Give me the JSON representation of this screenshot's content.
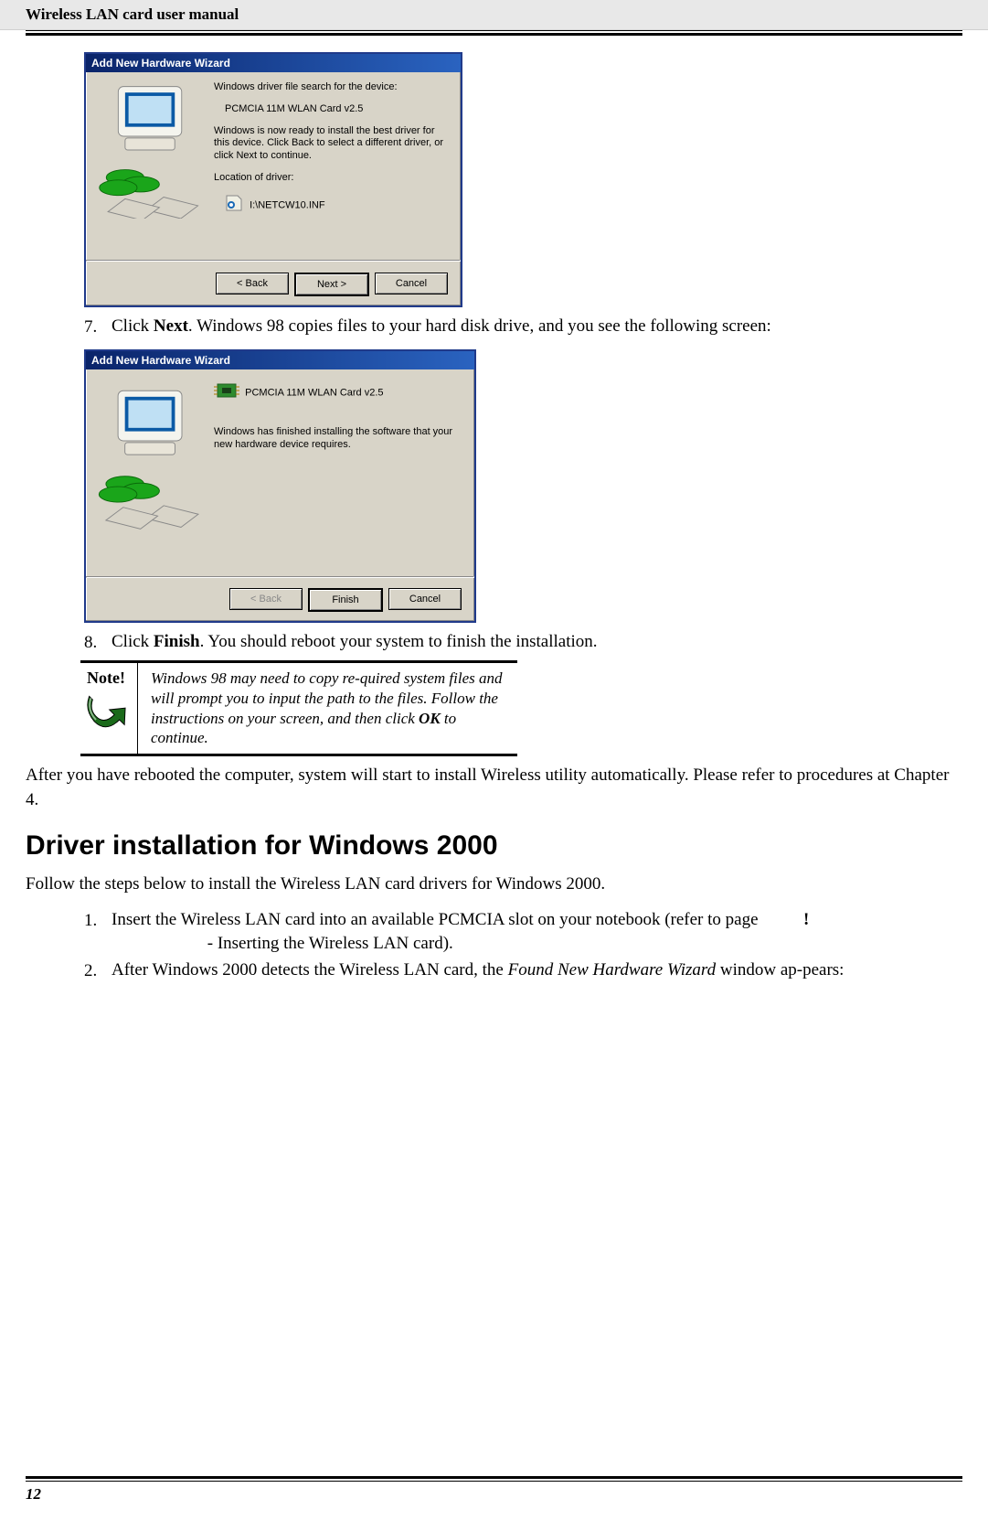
{
  "header": {
    "title": "Wireless LAN card user manual"
  },
  "screenshot1": {
    "titlebar": "Add New Hardware Wizard",
    "line1": "Windows driver file search for the device:",
    "device": "PCMCIA 11M WLAN Card v2.5",
    "ready": "Windows is now ready to install the best driver for this device. Click Back to select a different driver, or click Next to continue.",
    "loc_label": "Location of driver:",
    "loc_path": "I:\\NETCW10.INF",
    "btn_back": "< Back",
    "btn_next": "Next >",
    "btn_cancel": "Cancel"
  },
  "step7": {
    "num": "7.",
    "text_a": "Click ",
    "text_b": "Next",
    "text_c": ". Windows 98 copies files to your hard disk drive, and you see the following screen:"
  },
  "screenshot2": {
    "titlebar": "Add New Hardware Wizard",
    "device": "PCMCIA 11M WLAN Card v2.5",
    "finished": "Windows has finished installing the software that your new hardware device requires.",
    "btn_back": "< Back",
    "btn_finish": "Finish",
    "btn_cancel": "Cancel"
  },
  "step8": {
    "num": "8.",
    "text_a": "Click ",
    "text_b": "Finish",
    "text_c": ". You should reboot your system to finish the installation."
  },
  "note": {
    "label": "Note!",
    "text_a": "Windows 98 may need to copy re-quired system files and will prompt you to input the path to the files.  Follow the instructions on your screen, and then click ",
    "ok": "OK",
    "text_b": " to continue."
  },
  "after_reboot": "After you have rebooted the computer, system will start to install Wireless utility automatically. Please refer to procedures at Chapter 4.",
  "section_title": "Driver installation for Windows 2000",
  "intro2000": "Follow the steps below to install the Wireless LAN card drivers for Windows 2000.",
  "w2k_step1": {
    "num": "1.",
    "text_a": "Insert the Wireless LAN card into an available PCMCIA slot on your notebook (refer to page ",
    "bang": "!",
    "text_b": " - Inserting the Wireless LAN card)."
  },
  "w2k_step2": {
    "num": "2.",
    "text_a": "After Windows 2000 detects the Wireless LAN card, the ",
    "italic": "Found New Hardware Wizard",
    "text_b": " window ap-pears:"
  },
  "page_number": "12"
}
